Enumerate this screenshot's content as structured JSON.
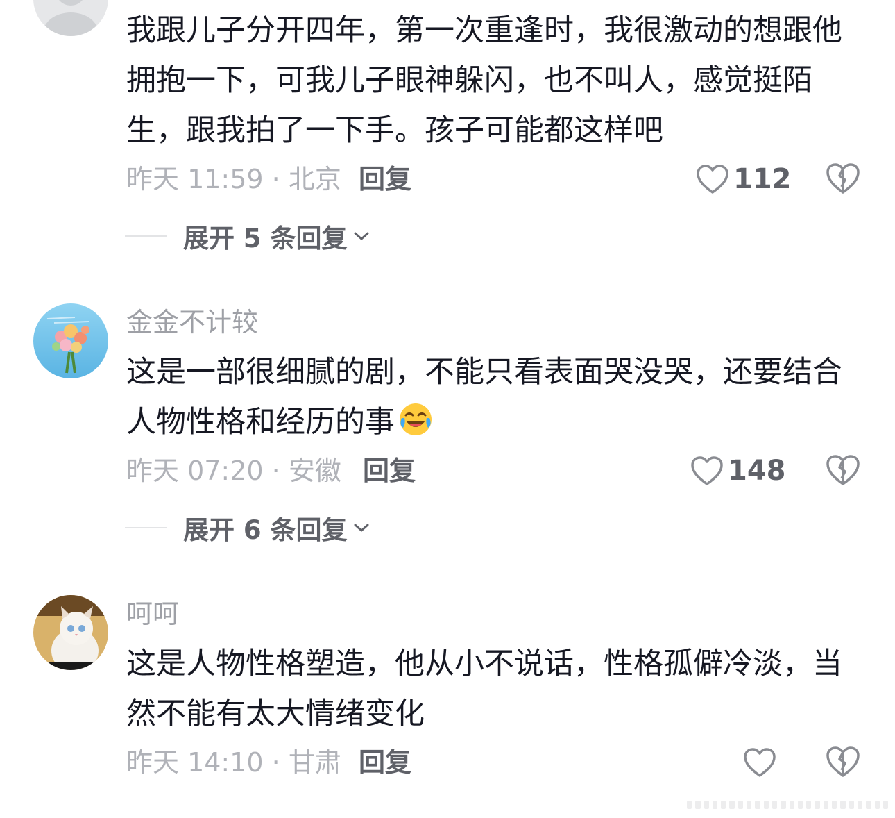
{
  "comments": [
    {
      "username": "",
      "content": "我跟儿子分开四年，第一次重逢时，我很激动的想跟他拥抱一下，可我儿子眼神躲闪，也不叫人，感觉挺陌生，跟我拍了一下手。孩子可能都这样吧",
      "time_location": "昨天 11:59 · 北京",
      "reply_label": "回复",
      "like_count": "112",
      "expand_label": "展开 5 条回复"
    },
    {
      "username": "金金不计较",
      "content": "这是一部很细腻的剧，不能只看表面哭没哭，还要结合人物性格和经历的事",
      "emoji": "laughing-crying-emoji",
      "time_location": "昨天 07:20 · 安徽",
      "reply_label": "回复",
      "like_count": "148",
      "expand_label": "展开 6 条回复"
    },
    {
      "username": "呵呵",
      "content": "这是人物性格塑造，他从小不说话，性格孤僻冷淡，当然不能有太大情绪变化",
      "time_location": "昨天 14:10 · 甘肃",
      "reply_label": "回复",
      "like_count": ""
    }
  ],
  "icons": {
    "like": "heart-outline-icon",
    "dislike": "broken-heart-icon",
    "expand": "chevron-down-icon"
  },
  "colors": {
    "text_primary": "#161823",
    "text_secondary": "#9ea0a6",
    "action": "#5f6168"
  }
}
